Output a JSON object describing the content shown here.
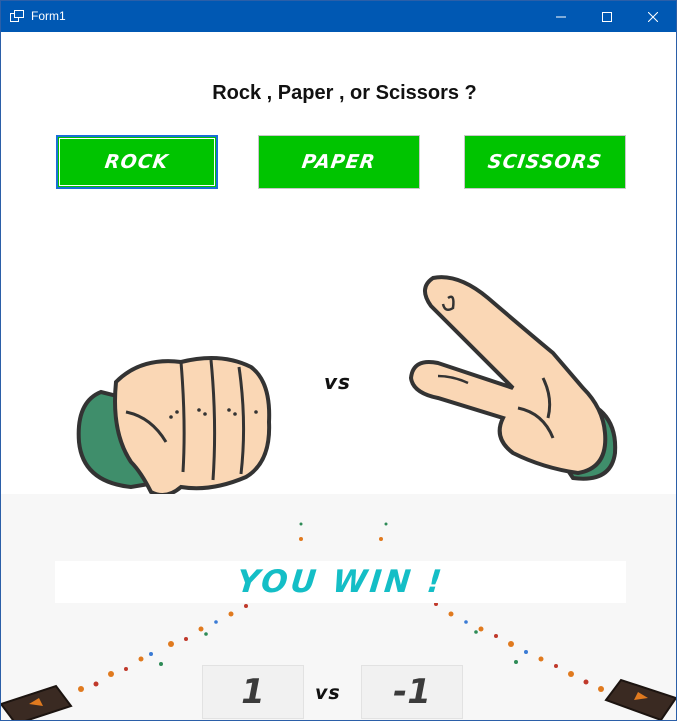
{
  "window": {
    "title": "Form1"
  },
  "prompt": "Rock  , Paper , or Scissors ?",
  "choices": {
    "rock": "ROCK",
    "paper": "PAPER",
    "scissors": "SCISSORS"
  },
  "versus": "vs",
  "player_hand": "rock-fist",
  "computer_hand": "scissors-hand",
  "result": "YOU WIN !",
  "score": {
    "player": "1",
    "separator": "vs",
    "computer": "-1"
  },
  "colors": {
    "titlebar": "#0058b3",
    "button": "#00c400",
    "result_text": "#14bec6",
    "focus_border": "#1a6fd6"
  }
}
